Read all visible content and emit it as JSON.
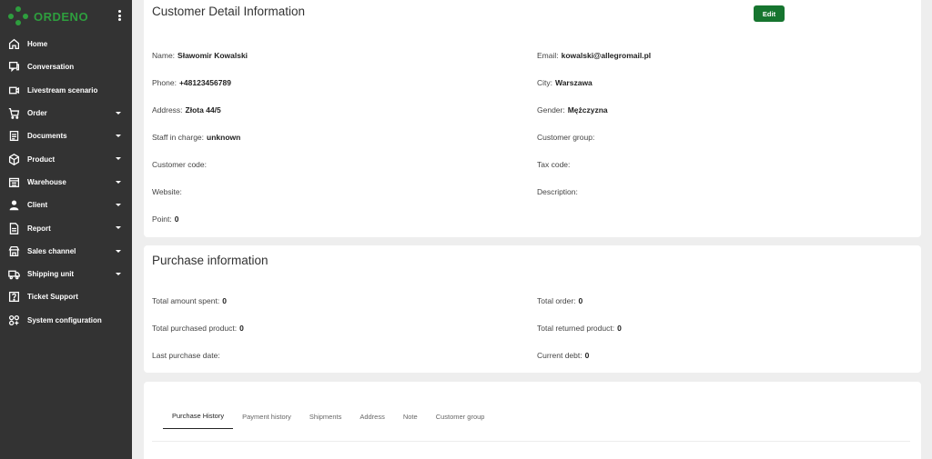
{
  "brand": {
    "name": "ORDENO",
    "color": "#2e9e3e"
  },
  "sidebar": {
    "items": [
      {
        "label": "Home",
        "icon": "home-icon",
        "caret": false
      },
      {
        "label": "Conversation",
        "icon": "chat-icon",
        "caret": false
      },
      {
        "label": "Livestream scenario",
        "icon": "video-icon",
        "caret": false
      },
      {
        "label": "Order",
        "icon": "cart-icon",
        "caret": true
      },
      {
        "label": "Documents",
        "icon": "document-icon",
        "caret": true
      },
      {
        "label": "Product",
        "icon": "box-icon",
        "caret": true
      },
      {
        "label": "Warehouse",
        "icon": "warehouse-icon",
        "caret": true
      },
      {
        "label": "Client",
        "icon": "user-icon",
        "caret": true
      },
      {
        "label": "Report",
        "icon": "report-icon",
        "caret": true
      },
      {
        "label": "Sales channel",
        "icon": "store-icon",
        "caret": true
      },
      {
        "label": "Shipping unit",
        "icon": "truck-icon",
        "caret": true
      },
      {
        "label": "Ticket Support",
        "icon": "question-icon",
        "caret": false
      },
      {
        "label": "System configuration",
        "icon": "grid-icon",
        "caret": false
      }
    ]
  },
  "customer": {
    "title": "Customer Detail Information",
    "edit_label": "Edit",
    "name_label": "Name:",
    "name": "Sławomir Kowalski",
    "email_label": "Email:",
    "email": "kowalski@allegromail.pl",
    "phone_label": "Phone:",
    "phone": "+48123456789",
    "city_label": "City:",
    "city": "Warszawa",
    "address_label": "Address:",
    "address": "Złota 44/5",
    "gender_label": "Gender:",
    "gender": "Mężczyzna",
    "staff_label": "Staff in charge:",
    "staff": "unknown",
    "group_label": "Customer group:",
    "group": "",
    "code_label": "Customer code:",
    "code": "",
    "tax_label": "Tax code:",
    "tax": "",
    "website_label": "Website:",
    "website": "",
    "description_label": "Description:",
    "description": "",
    "point_label": "Point:",
    "point": "0"
  },
  "purchase": {
    "title": "Purchase information",
    "total_spent_label": "Total amount spent:",
    "total_spent": "0",
    "total_order_label": "Total order:",
    "total_order": "0",
    "purchased_label": "Total purchased product:",
    "purchased": "0",
    "returned_label": "Total returned product:",
    "returned": "0",
    "last_date_label": "Last purchase date:",
    "last_date": "",
    "debt_label": "Current debt:",
    "debt": "0"
  },
  "tabs": [
    "Purchase History",
    "Payment history",
    "Shipments",
    "Address",
    "Note",
    "Customer group"
  ],
  "active_tab": "Purchase History",
  "colors": {
    "sidebar_bg": "#333333",
    "accent": "#16752f",
    "page_bg": "#eeeeee"
  }
}
